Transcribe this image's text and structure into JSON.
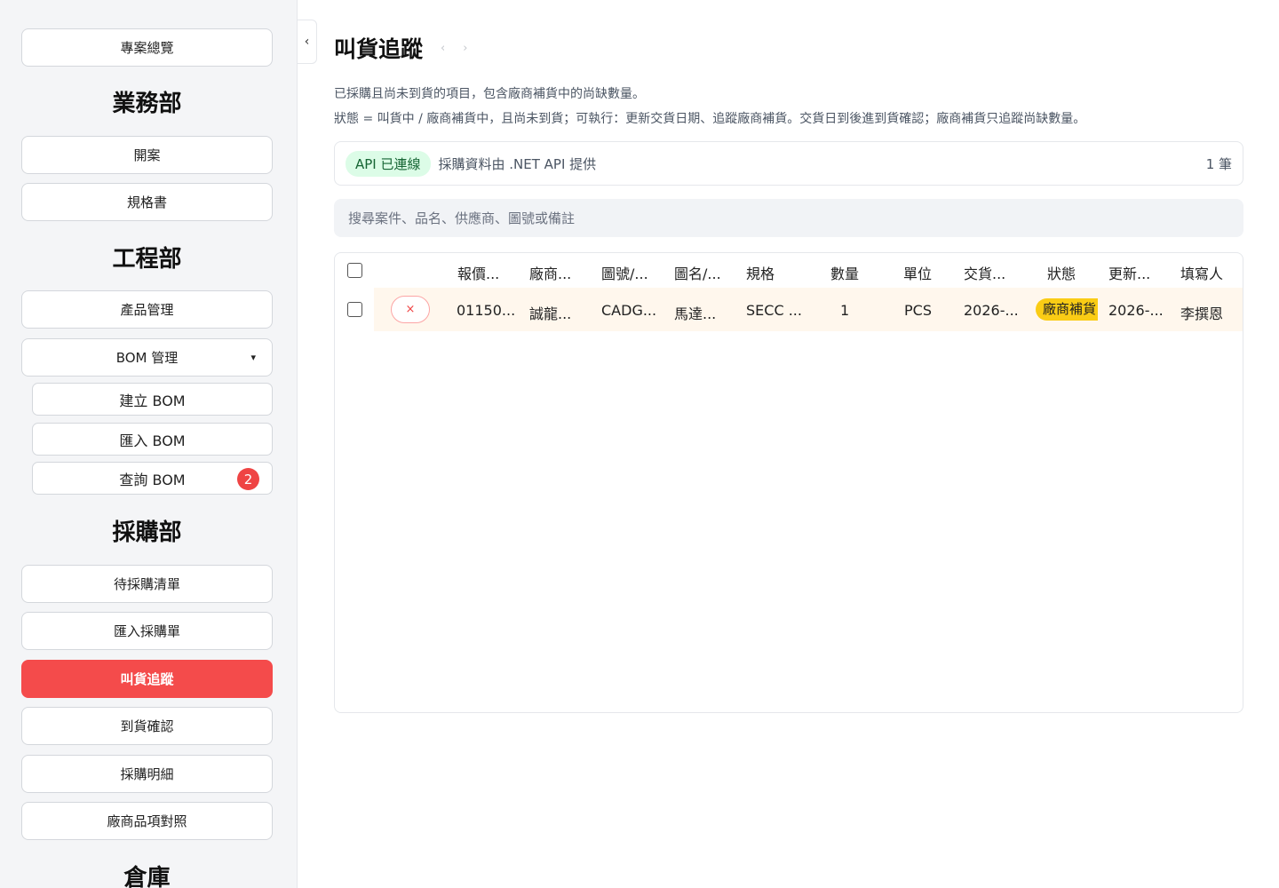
{
  "sidebar": {
    "overview": "專案總覽",
    "sales_dept": "業務部",
    "open_case": "開案",
    "spec": "規格書",
    "eng_dept": "工程部",
    "product_mgmt": "產品管理",
    "bom_mgmt": "BOM 管理",
    "bom_caret": "▾",
    "create_bom": "建立 BOM",
    "import_bom": "匯入 BOM",
    "query_bom": "查詢 BOM",
    "query_bom_badge": "2",
    "purchase_dept": "採購部",
    "pending_purchase": "待採購清單",
    "import_po": "匯入採購單",
    "order_tracking": "叫貨追蹤",
    "arrival_confirm": "到貨確認",
    "purchase_detail": "採購明細",
    "vendor_items": "廠商品項對照",
    "warehouse": "倉庫"
  },
  "collapse_icon": "‹",
  "header": {
    "title": "叫貨追蹤",
    "prev": "‹",
    "next": "›",
    "desc1": "已採購且尚未到貨的項目，包含廠商補貨中的尚缺數量。",
    "desc2": "狀態 = 叫貨中 / 廠商補貨中，且尚未到貨；可執行：更新交貨日期、追蹤廠商補貨。交貨日到後進到貨確認；廠商補貨只追蹤尚缺數量。"
  },
  "api": {
    "status": "API 已連線",
    "text": "採購資料由 .NET API 提供",
    "count": "1 筆"
  },
  "search": {
    "placeholder": "搜尋案件、品名、供應商、圖號或備註"
  },
  "table": {
    "headers": {
      "quote": "報價...",
      "vendor": "廠商...",
      "drawing_no": "圖號/...",
      "drawing_name": "圖名/...",
      "spec": "規格",
      "qty": "數量",
      "unit": "單位",
      "delivery": "交貨...",
      "status": "狀態",
      "updated": "更新...",
      "filler": "填寫人"
    },
    "rows": [
      {
        "delete": "×",
        "quote": "01150...",
        "vendor": "誠龍...",
        "drawing_no": "CADG...",
        "drawing_name": "馬達...",
        "spec": "SECC ...",
        "qty": "1",
        "unit": "PCS",
        "delivery": "2026-...",
        "status": "廠商補貨",
        "updated": "2026-...",
        "filler": "李撰恩"
      }
    ]
  },
  "colors": {
    "active": "#f44b4b",
    "api_pill_bg": "#dcfce7",
    "status_pill": "#facc15",
    "row_highlight": "#fff7ed"
  }
}
